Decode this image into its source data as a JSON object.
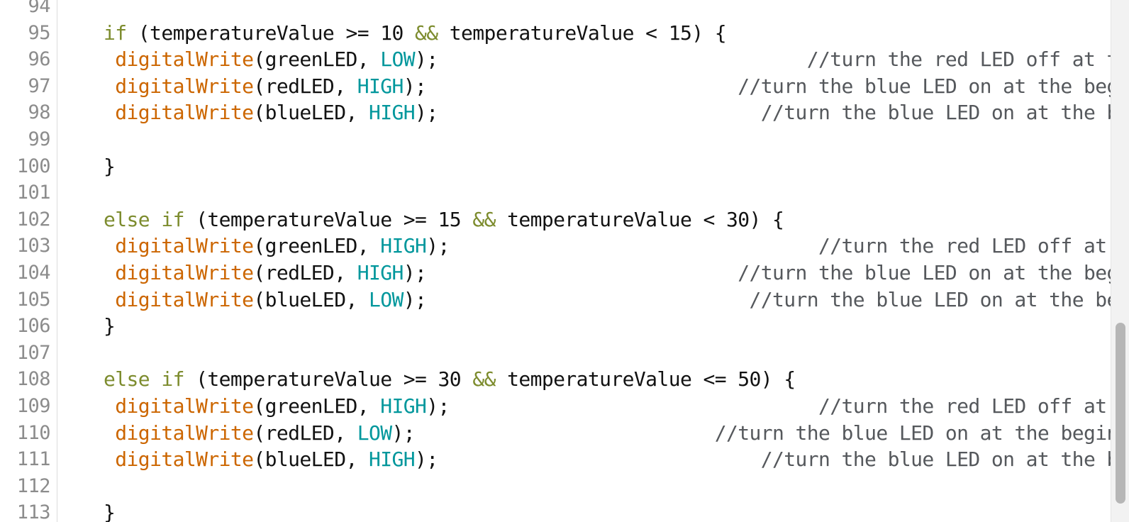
{
  "editor": {
    "kind": "arduino-code-editor",
    "language": "arduino-c",
    "background_color": "#ffffff",
    "gutter_color": "#8c8c8c",
    "comment_color": "#55585c",
    "keyword_color": "#7d8c2e",
    "function_color": "#cc6600",
    "constant_color": "#00979c",
    "plain_color": "#121212"
  },
  "scrollbar": {
    "orientation": "vertical",
    "track_color": "#f2f2f2",
    "thumb_color": "#b6b6b6"
  },
  "gutter": {
    "line_numbers": [
      "94",
      "95",
      "96",
      "97",
      "98",
      "99",
      "100",
      "101",
      "102",
      "103",
      "104",
      "105",
      "106",
      "107",
      "108",
      "109",
      "110",
      "111",
      "112",
      "113"
    ]
  },
  "code": {
    "lines": [
      {
        "number": "94",
        "tokens": []
      },
      {
        "number": "95",
        "tokens": [
          {
            "t": "plain",
            "v": "    "
          },
          {
            "t": "kw",
            "v": "if"
          },
          {
            "t": "plain",
            "v": " (temperatureValue "
          },
          {
            "t": "plain",
            "v": ">="
          },
          {
            "t": "plain",
            "v": " "
          },
          {
            "t": "num",
            "v": "10"
          },
          {
            "t": "plain",
            "v": " "
          },
          {
            "t": "op",
            "v": "&&"
          },
          {
            "t": "plain",
            "v": " temperatureValue "
          },
          {
            "t": "plain",
            "v": "<"
          },
          {
            "t": "plain",
            "v": " "
          },
          {
            "t": "num",
            "v": "15"
          },
          {
            "t": "plain",
            "v": ") {"
          }
        ]
      },
      {
        "number": "96",
        "tokens": [
          {
            "t": "plain",
            "v": "     "
          },
          {
            "t": "fn",
            "v": "digitalWrite"
          },
          {
            "t": "plain",
            "v": "(greenLED, "
          },
          {
            "t": "const",
            "v": "LOW"
          },
          {
            "t": "plain",
            "v": ");"
          },
          {
            "t": "plain",
            "v": "                                "
          },
          {
            "t": "comment",
            "v": "//turn the red LED off at the beginning"
          }
        ]
      },
      {
        "number": "97",
        "tokens": [
          {
            "t": "plain",
            "v": "     "
          },
          {
            "t": "fn",
            "v": "digitalWrite"
          },
          {
            "t": "plain",
            "v": "(redLED, "
          },
          {
            "t": "const",
            "v": "HIGH"
          },
          {
            "t": "plain",
            "v": ");"
          },
          {
            "t": "plain",
            "v": "                           "
          },
          {
            "t": "comment",
            "v": "//turn the blue LED on at the beginning"
          }
        ]
      },
      {
        "number": "98",
        "tokens": [
          {
            "t": "plain",
            "v": "     "
          },
          {
            "t": "fn",
            "v": "digitalWrite"
          },
          {
            "t": "plain",
            "v": "(blueLED, "
          },
          {
            "t": "const",
            "v": "HIGH"
          },
          {
            "t": "plain",
            "v": ");"
          },
          {
            "t": "plain",
            "v": "                            "
          },
          {
            "t": "comment",
            "v": "//turn the blue LED on at the beginning"
          }
        ]
      },
      {
        "number": "99",
        "tokens": []
      },
      {
        "number": "100",
        "tokens": [
          {
            "t": "plain",
            "v": "    }"
          }
        ]
      },
      {
        "number": "101",
        "tokens": []
      },
      {
        "number": "102",
        "tokens": [
          {
            "t": "plain",
            "v": "    "
          },
          {
            "t": "kw",
            "v": "else if"
          },
          {
            "t": "plain",
            "v": " (temperatureValue "
          },
          {
            "t": "plain",
            "v": ">="
          },
          {
            "t": "plain",
            "v": " "
          },
          {
            "t": "num",
            "v": "15"
          },
          {
            "t": "plain",
            "v": " "
          },
          {
            "t": "op",
            "v": "&&"
          },
          {
            "t": "plain",
            "v": " temperatureValue "
          },
          {
            "t": "plain",
            "v": "<"
          },
          {
            "t": "plain",
            "v": " "
          },
          {
            "t": "num",
            "v": "30"
          },
          {
            "t": "plain",
            "v": ") {"
          }
        ]
      },
      {
        "number": "103",
        "tokens": [
          {
            "t": "plain",
            "v": "     "
          },
          {
            "t": "fn",
            "v": "digitalWrite"
          },
          {
            "t": "plain",
            "v": "(greenLED, "
          },
          {
            "t": "const",
            "v": "HIGH"
          },
          {
            "t": "plain",
            "v": ");"
          },
          {
            "t": "plain",
            "v": "                                "
          },
          {
            "t": "comment",
            "v": "//turn the red LED off at the beginning"
          }
        ]
      },
      {
        "number": "104",
        "tokens": [
          {
            "t": "plain",
            "v": "     "
          },
          {
            "t": "fn",
            "v": "digitalWrite"
          },
          {
            "t": "plain",
            "v": "(redLED, "
          },
          {
            "t": "const",
            "v": "HIGH"
          },
          {
            "t": "plain",
            "v": ");"
          },
          {
            "t": "plain",
            "v": "                           "
          },
          {
            "t": "comment",
            "v": "//turn the blue LED on at the beginning"
          }
        ]
      },
      {
        "number": "105",
        "tokens": [
          {
            "t": "plain",
            "v": "     "
          },
          {
            "t": "fn",
            "v": "digitalWrite"
          },
          {
            "t": "plain",
            "v": "(blueLED, "
          },
          {
            "t": "const",
            "v": "LOW"
          },
          {
            "t": "plain",
            "v": ");"
          },
          {
            "t": "plain",
            "v": "                            "
          },
          {
            "t": "comment",
            "v": "//turn the blue LED on at the beginning"
          }
        ]
      },
      {
        "number": "106",
        "tokens": [
          {
            "t": "plain",
            "v": "    }"
          }
        ]
      },
      {
        "number": "107",
        "tokens": []
      },
      {
        "number": "108",
        "tokens": [
          {
            "t": "plain",
            "v": "    "
          },
          {
            "t": "kw",
            "v": "else if"
          },
          {
            "t": "plain",
            "v": " (temperatureValue "
          },
          {
            "t": "plain",
            "v": ">="
          },
          {
            "t": "plain",
            "v": " "
          },
          {
            "t": "num",
            "v": "30"
          },
          {
            "t": "plain",
            "v": " "
          },
          {
            "t": "op",
            "v": "&&"
          },
          {
            "t": "plain",
            "v": " temperatureValue "
          },
          {
            "t": "plain",
            "v": "<="
          },
          {
            "t": "plain",
            "v": " "
          },
          {
            "t": "num",
            "v": "50"
          },
          {
            "t": "plain",
            "v": ") {"
          }
        ]
      },
      {
        "number": "109",
        "tokens": [
          {
            "t": "plain",
            "v": "     "
          },
          {
            "t": "fn",
            "v": "digitalWrite"
          },
          {
            "t": "plain",
            "v": "(greenLED, "
          },
          {
            "t": "const",
            "v": "HIGH"
          },
          {
            "t": "plain",
            "v": ");"
          },
          {
            "t": "plain",
            "v": "                                "
          },
          {
            "t": "comment",
            "v": "//turn the red LED off at the beginning"
          }
        ]
      },
      {
        "number": "110",
        "tokens": [
          {
            "t": "plain",
            "v": "     "
          },
          {
            "t": "fn",
            "v": "digitalWrite"
          },
          {
            "t": "plain",
            "v": "(redLED, "
          },
          {
            "t": "const",
            "v": "LOW"
          },
          {
            "t": "plain",
            "v": ");"
          },
          {
            "t": "plain",
            "v": "                          "
          },
          {
            "t": "comment",
            "v": "//turn the blue LED on at the beginning"
          }
        ]
      },
      {
        "number": "111",
        "tokens": [
          {
            "t": "plain",
            "v": "     "
          },
          {
            "t": "fn",
            "v": "digitalWrite"
          },
          {
            "t": "plain",
            "v": "(blueLED, "
          },
          {
            "t": "const",
            "v": "HIGH"
          },
          {
            "t": "plain",
            "v": ");"
          },
          {
            "t": "plain",
            "v": "                            "
          },
          {
            "t": "comment",
            "v": "//turn the blue LED on at the beginning"
          }
        ]
      },
      {
        "number": "112",
        "tokens": []
      },
      {
        "number": "113",
        "tokens": [
          {
            "t": "plain",
            "v": "    }"
          }
        ]
      }
    ]
  }
}
